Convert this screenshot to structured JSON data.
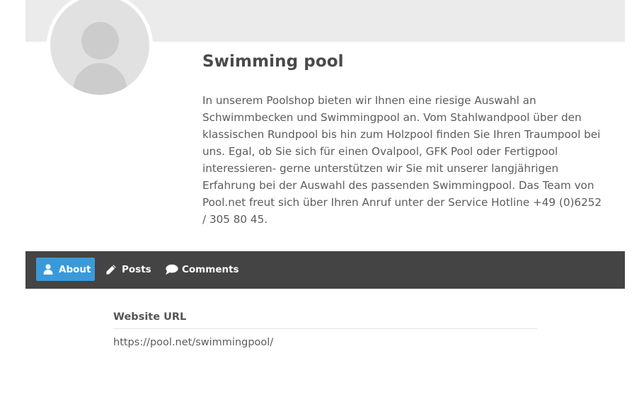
{
  "profile": {
    "name": "Swimming pool",
    "bio": "In unserem Poolshop bieten wir Ihnen eine riesige Auswahl an Schwimmbecken und Swimmingpool an. Vom Stahlwandpool über den klassischen Rundpool bis hin zum Holzpool finden Sie Ihren Traumpool bei uns. Egal, ob Sie sich für einen Ovalpool, GFK Pool oder Fertigpool interessieren- gerne unterstützen wir Sie mit unserer langjährigen Erfahrung bei der Auswahl des passenden Swimmingpool. Das Team von Pool.net freut sich über Ihren Anruf unter der Service Hotline +49 (0)6252 / 305 80 45."
  },
  "tabs": {
    "about": {
      "label": "About",
      "icon": "user-icon",
      "active": true
    },
    "posts": {
      "label": "Posts",
      "icon": "pencil-icon",
      "active": false
    },
    "comments": {
      "label": "Comments",
      "icon": "speech-bubble-icon",
      "active": false
    }
  },
  "details": {
    "website_label": "Website URL",
    "website_value": "https://pool.net/swimmingpool/"
  },
  "colors": {
    "accent": "#3a9ad9",
    "nav_background": "#444444",
    "cover_background": "#ebebeb"
  }
}
